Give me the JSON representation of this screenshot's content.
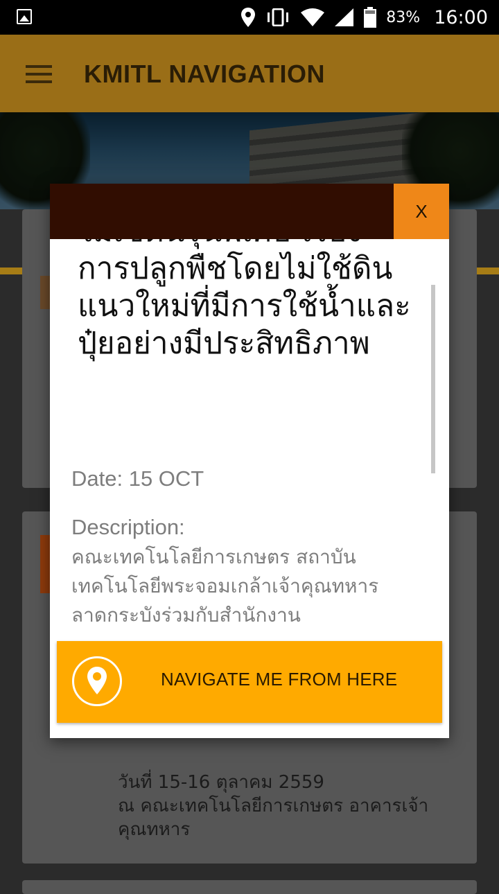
{
  "status_bar": {
    "battery_percent": "83%",
    "time": "16:00",
    "icons": [
      "image-icon",
      "location-icon",
      "vibrate-icon",
      "wifi-icon",
      "signal-icon",
      "battery-icon"
    ]
  },
  "app_bar": {
    "title": "KMITL NAVIGATION",
    "menu_icon": "hamburger-icon"
  },
  "background_card": {
    "text": "วันที่ 15-16 ตุลาคม 2559\nณ คณะเทคโนโลยีการเกษตร อาคารเจ้าคุณทหาร"
  },
  "modal": {
    "close_label": "X",
    "title": "ไม่เซตนรุ่นพิเศษ เรื่อง การปลูกพืชโดยไม่ใช้ดินแนวใหม่ที่มีการใช้น้ำและปุ๋ยอย่างมีประสิทธิภาพ",
    "date": "Date: 15 OCT",
    "description_label": "Description:",
    "description": "คณะเทคโนโลยีการเกษตร สถาบันเทคโนโลยีพระจอมเกล้าเจ้าคุณทหารลาดกระบังร่วมกับสำนักงาน",
    "navigate_label": "NAVIGATE ME FROM HERE",
    "navigate_icon": "map-pin-icon"
  },
  "colors": {
    "app_bar": "#9a6e17",
    "modal_header": "#310d01",
    "close_button": "#ef8718",
    "navigate_button": "#ffaa00"
  }
}
